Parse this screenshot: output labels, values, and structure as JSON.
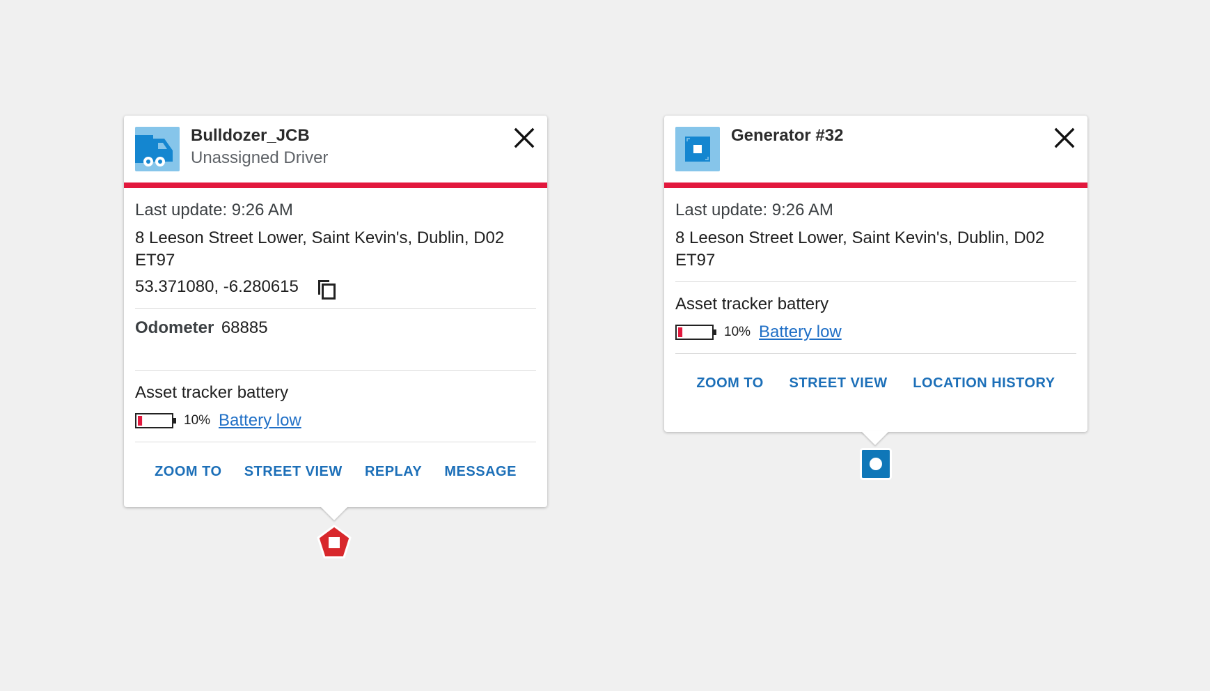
{
  "colors": {
    "status_bar": "#e2183d",
    "action": "#1c6fb8",
    "link": "#1f6fc6",
    "icon_bg": "#86c5ea",
    "icon_blue": "#1486d0",
    "marker_red": "#d8282c",
    "marker_blue": "#0f77b8"
  },
  "cards": [
    {
      "icon": "truck-icon",
      "title": "Bulldozer_JCB",
      "subtitle": "Unassigned Driver",
      "last_update": "Last update: 9:26 AM",
      "address": "8 Leeson Street Lower, Saint Kevin's, Dublin, D02 ET97",
      "coordinates": "53.371080, -6.280615",
      "odometer_label": "Odometer",
      "odometer_value": "68885",
      "battery_title": "Asset tracker battery",
      "battery_level": 0.1,
      "battery_pct": "10%",
      "battery_status": "Battery low",
      "actions": [
        "ZOOM TO",
        "STREET VIEW",
        "REPLAY",
        "MESSAGE"
      ],
      "marker": "pentagon-stop-marker-icon"
    },
    {
      "icon": "generator-icon",
      "title": "Generator #32",
      "last_update": "Last update: 9:26 AM",
      "address": "8 Leeson Street Lower, Saint Kevin's, Dublin, D02 ET97",
      "battery_title": "Asset tracker battery",
      "battery_level": 0.1,
      "battery_pct": "10%",
      "battery_status": "Battery low",
      "actions": [
        "ZOOM TO",
        "STREET VIEW",
        "LOCATION HISTORY"
      ],
      "marker": "square-dot-marker-icon"
    }
  ]
}
